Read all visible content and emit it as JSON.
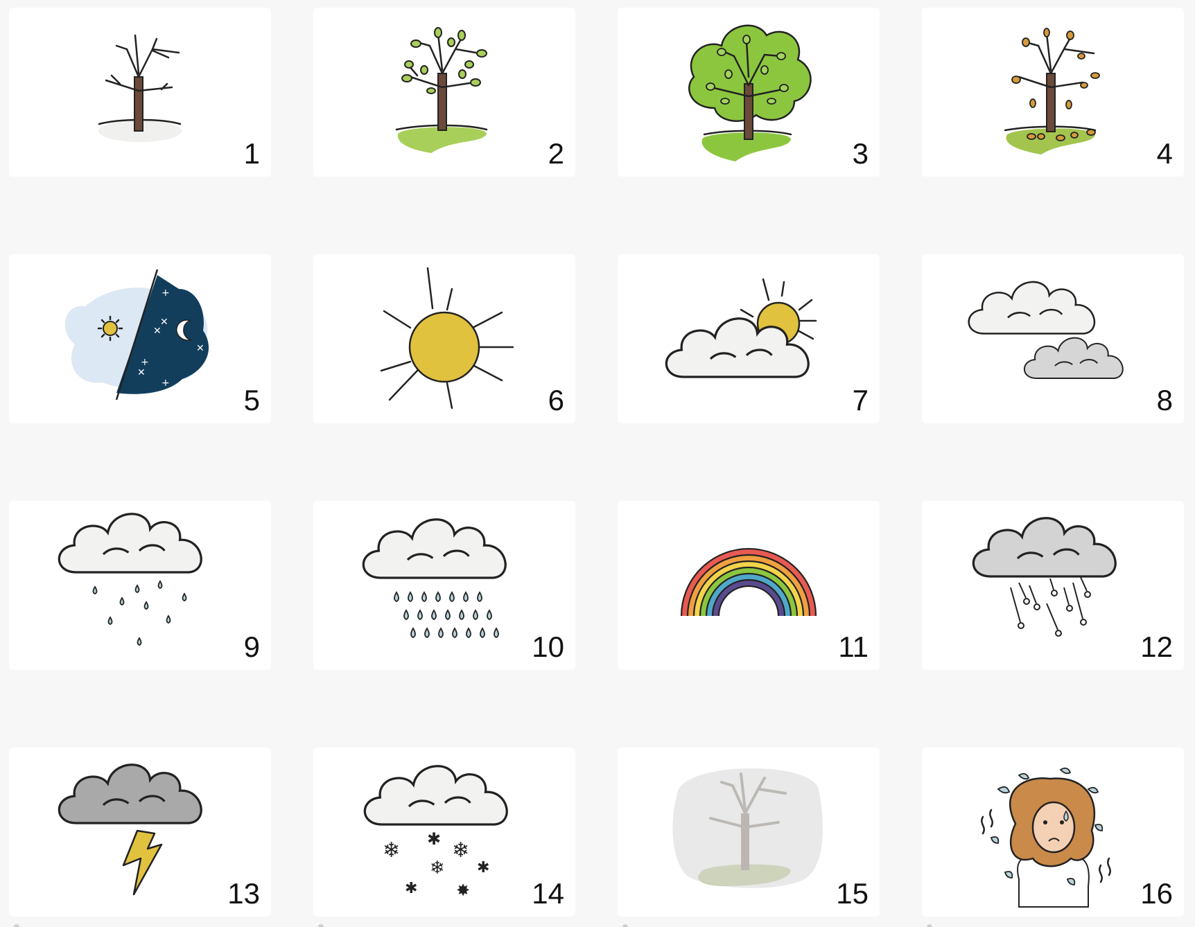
{
  "cards": [
    {
      "number": "1",
      "icon": "bare-tree-winter-icon"
    },
    {
      "number": "2",
      "icon": "budding-tree-spring-icon"
    },
    {
      "number": "3",
      "icon": "leafy-tree-summer-icon"
    },
    {
      "number": "4",
      "icon": "falling-leaves-tree-autumn-icon"
    },
    {
      "number": "5",
      "icon": "day-night-icon"
    },
    {
      "number": "6",
      "icon": "sun-icon"
    },
    {
      "number": "7",
      "icon": "sun-behind-cloud-icon"
    },
    {
      "number": "8",
      "icon": "two-clouds-icon"
    },
    {
      "number": "9",
      "icon": "light-rain-cloud-icon"
    },
    {
      "number": "10",
      "icon": "heavy-rain-cloud-icon"
    },
    {
      "number": "11",
      "icon": "rainbow-icon"
    },
    {
      "number": "12",
      "icon": "hail-cloud-icon"
    },
    {
      "number": "13",
      "icon": "thunderstorm-cloud-icon"
    },
    {
      "number": "14",
      "icon": "snow-cloud-icon"
    },
    {
      "number": "15",
      "icon": "foggy-tree-icon"
    },
    {
      "number": "16",
      "icon": "wind-blown-girl-icon"
    }
  ],
  "colors": {
    "background": "#f7f7f7",
    "card": "#ffffff",
    "trunk": "#6b4a3a",
    "leaf_green": "#8cc63f",
    "grass": "#a8cf5a",
    "sun": "#e1c23f",
    "cloud": "#f2f2f0",
    "grey_cloud": "#c9c9c9",
    "dark_cloud": "#a9a9a9",
    "night": "#123e5c",
    "day": "#dce8f4",
    "drop": "#b8d4dc"
  }
}
